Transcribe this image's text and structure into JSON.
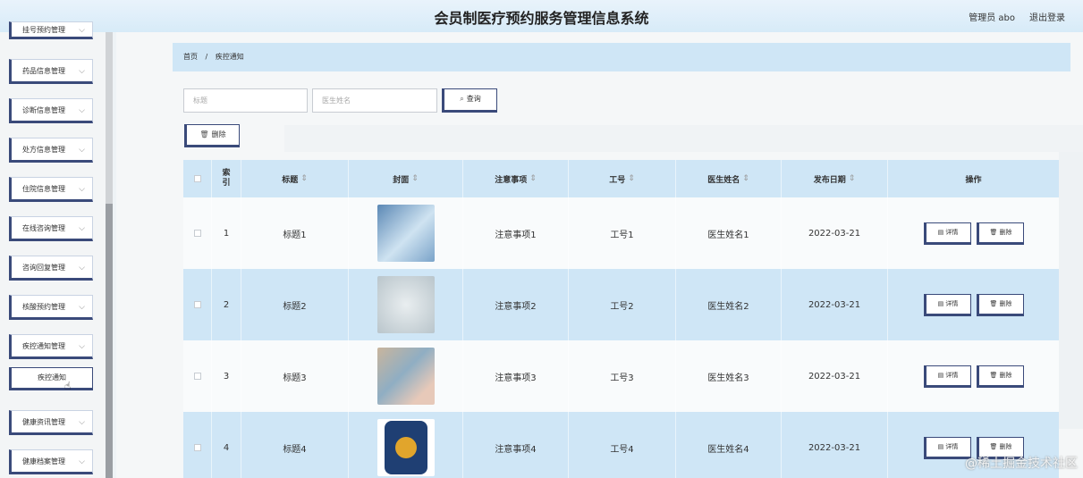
{
  "header": {
    "title": "会员制医疗预约服务管理信息系统",
    "admin_label": "管理员 abo",
    "logout_label": "退出登录"
  },
  "sidebar": {
    "items": [
      {
        "label": "挂号预约管理"
      },
      {
        "label": "药品信息管理"
      },
      {
        "label": "诊断信息管理"
      },
      {
        "label": "处方信息管理"
      },
      {
        "label": "住院信息管理"
      },
      {
        "label": "在线咨询管理"
      },
      {
        "label": "咨询回复管理"
      },
      {
        "label": "核酸预约管理"
      },
      {
        "label": "疾控通知管理"
      },
      {
        "label": "健康资讯管理"
      },
      {
        "label": "健康档案管理"
      }
    ],
    "sub_item": "疾控通知"
  },
  "breadcrumb": {
    "home": "首页",
    "sep": "/",
    "current": "疾控通知"
  },
  "search": {
    "title_placeholder": "标题",
    "doctor_placeholder": "医生姓名",
    "query_label": "查询"
  },
  "toolbar": {
    "delete_label": "删除"
  },
  "table": {
    "headers": [
      "索引",
      "标题",
      "封面",
      "注意事项",
      "工号",
      "医生姓名",
      "发布日期",
      "操作"
    ],
    "rows": [
      {
        "index": "1",
        "title": "标题1",
        "note": "注意事项1",
        "job_no": "工号1",
        "doctor": "医生姓名1",
        "date": "2022-03-21"
      },
      {
        "index": "2",
        "title": "标题2",
        "note": "注意事项2",
        "job_no": "工号2",
        "doctor": "医生姓名2",
        "date": "2022-03-21"
      },
      {
        "index": "3",
        "title": "标题3",
        "note": "注意事项3",
        "job_no": "工号3",
        "doctor": "医生姓名3",
        "date": "2022-03-21"
      },
      {
        "index": "4",
        "title": "标题4",
        "note": "注意事项4",
        "job_no": "工号4",
        "doctor": "医生姓名4",
        "date": "2022-03-21"
      }
    ],
    "detail_label": "详情",
    "delete_label": "删除"
  },
  "watermark": "@稀土掘金技术社区"
}
